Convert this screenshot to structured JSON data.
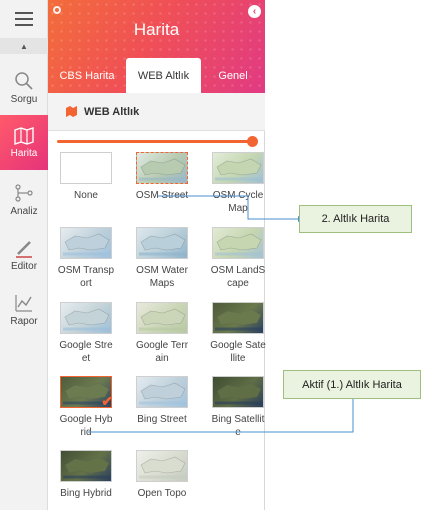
{
  "sidebar": {
    "items": [
      {
        "label": "Sorgu",
        "icon": "search-icon"
      },
      {
        "label": "Harita",
        "icon": "map-icon",
        "active": true
      },
      {
        "label": "Analiz",
        "icon": "analysis-icon"
      },
      {
        "label": "Editor",
        "icon": "pencil-icon"
      },
      {
        "label": "Rapor",
        "icon": "report-chart-icon"
      }
    ]
  },
  "panel": {
    "title": "Harita",
    "tabs": [
      "CBS Harita",
      "WEB Altlık",
      "Genel"
    ],
    "active_tab": "WEB Altlık",
    "section_title": "WEB Altlık",
    "opacity_percent": 100
  },
  "basemaps": [
    {
      "label_lines": [
        "None",
        ""
      ],
      "state": "none"
    },
    {
      "label_lines": [
        "OSM Street",
        ""
      ],
      "state": "secondary"
    },
    {
      "label_lines": [
        "OSM Cycle",
        "Map"
      ],
      "state": ""
    },
    {
      "label_lines": [
        "OSM Transp",
        "ort"
      ],
      "state": ""
    },
    {
      "label_lines": [
        "OSM Water",
        "Maps"
      ],
      "state": ""
    },
    {
      "label_lines": [
        "OSM LandS",
        "cape"
      ],
      "state": ""
    },
    {
      "label_lines": [
        "Google Stre",
        "et"
      ],
      "state": ""
    },
    {
      "label_lines": [
        "Google Terr",
        "ain"
      ],
      "state": ""
    },
    {
      "label_lines": [
        "Google Sate",
        "llite"
      ],
      "state": ""
    },
    {
      "label_lines": [
        "Google Hyb",
        "rid"
      ],
      "state": "active"
    },
    {
      "label_lines": [
        "Bing Street",
        ""
      ],
      "state": ""
    },
    {
      "label_lines": [
        "Bing Satellit",
        "e"
      ],
      "state": ""
    },
    {
      "label_lines": [
        "Bing Hybrid",
        ""
      ],
      "state": ""
    },
    {
      "label_lines": [
        "Open Topo",
        ""
      ],
      "state": ""
    }
  ],
  "callouts": {
    "secondary": "2. Altlık Harita",
    "active": "Aktif (1.) Altlık Harita"
  },
  "colors": {
    "accent": "#f26532",
    "callout_bg": "#eaf3df",
    "callout_line": "#4a8fcf"
  }
}
